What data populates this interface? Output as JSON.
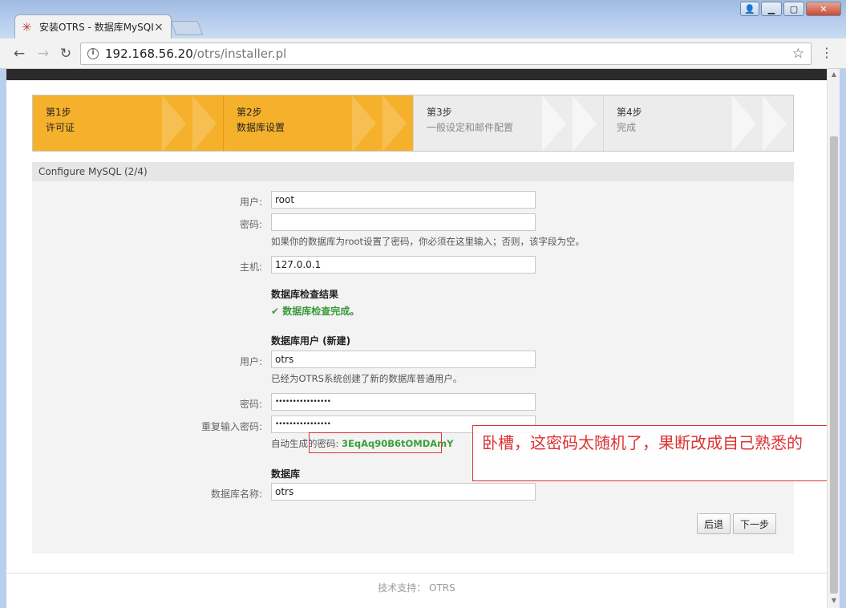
{
  "browser": {
    "tab_title": "安装OTRS - 数据库MySQL",
    "tab_close": "×",
    "url_host": "192.168.56.20",
    "url_path": "/otrs/installer.pl",
    "back": "←",
    "forward": "→",
    "reload": "↻",
    "star": "☆",
    "menu": "⋮"
  },
  "steps": [
    {
      "num": "第1步",
      "name": "许可证",
      "state": "done"
    },
    {
      "num": "第2步",
      "name": "数据库设置",
      "state": "active"
    },
    {
      "num": "第3步",
      "name": "一般设定和邮件配置",
      "state": "pending"
    },
    {
      "num": "第4步",
      "name": "完成",
      "state": "pending"
    }
  ],
  "panel": {
    "title": "Configure MySQL (2/4)"
  },
  "form": {
    "user_label": "用户:",
    "user_value": "root",
    "password_label": "密码:",
    "password_value": "",
    "password_hint": "如果你的数据库为root设置了密码，你必须在这里输入；否则，该字段为空。",
    "host_label": "主机:",
    "host_value": "127.0.0.1",
    "check_title": "数据库检查结果",
    "check_result": "✔ 数据库检查完成。",
    "dbuser_title": "数据库用户 (新建)",
    "dbuser_label": "用户:",
    "dbuser_value": "otrs",
    "dbuser_hint": "已经为OTRS系统创建了新的数据库普通用户。",
    "dbpass_label": "密码:",
    "dbpass_value": "••••••••••••••••",
    "dbpass2_label": "重复输入密码:",
    "dbpass2_value": "••••••••••••••••",
    "gen_label": "自动生成的密码:",
    "gen_value": "3EqAq90B6tOMDAmY",
    "db_title": "数据库",
    "dbname_label": "数据库名称:",
    "dbname_value": "otrs"
  },
  "buttons": {
    "back": "后退",
    "next": "下一步"
  },
  "annotation": {
    "note": "卧槽，这密码太随机了，果断改成自己熟悉的"
  },
  "footer": {
    "text": "技术支持： OTRS"
  },
  "colors": {
    "step_active": "#f6b12c",
    "step_pending": "#ececec",
    "success": "#3a9a3a",
    "annotation": "#dd3333"
  }
}
